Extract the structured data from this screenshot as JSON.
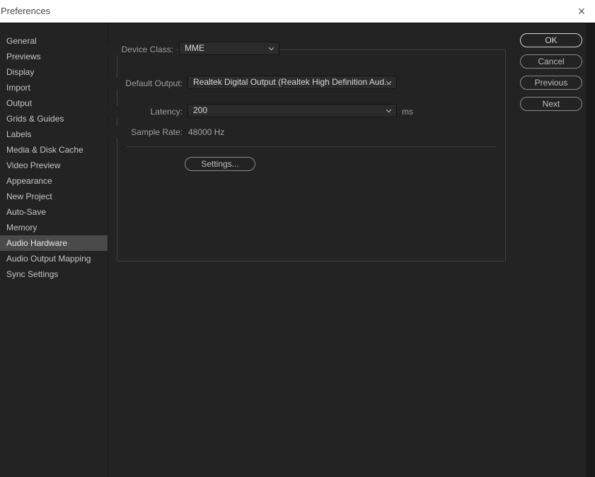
{
  "window": {
    "title": "Preferences",
    "close_glyph": "×"
  },
  "sidebar": {
    "items": [
      {
        "label": "General",
        "selected": false
      },
      {
        "label": "Previews",
        "selected": false
      },
      {
        "label": "Display",
        "selected": false
      },
      {
        "label": "Import",
        "selected": false
      },
      {
        "label": "Output",
        "selected": false
      },
      {
        "label": "Grids & Guides",
        "selected": false
      },
      {
        "label": "Labels",
        "selected": false
      },
      {
        "label": "Media & Disk Cache",
        "selected": false
      },
      {
        "label": "Video Preview",
        "selected": false
      },
      {
        "label": "Appearance",
        "selected": false
      },
      {
        "label": "New Project",
        "selected": false
      },
      {
        "label": "Auto-Save",
        "selected": false
      },
      {
        "label": "Memory",
        "selected": false
      },
      {
        "label": "Audio Hardware",
        "selected": true
      },
      {
        "label": "Audio Output Mapping",
        "selected": false
      },
      {
        "label": "Sync Settings",
        "selected": false
      }
    ]
  },
  "panel": {
    "device_class_label": "Device Class:",
    "device_class_value": "MME",
    "default_output_label": "Default Output:",
    "default_output_value": "Realtek Digital Output (Realtek High Definition Aud...",
    "latency_label": "Latency:",
    "latency_value": "200",
    "latency_unit": "ms",
    "sample_rate_label": "Sample Rate:",
    "sample_rate_value": "48000 Hz",
    "settings_button_label": "Settings..."
  },
  "action_buttons": {
    "ok": "OK",
    "cancel": "Cancel",
    "previous": "Previous",
    "next": "Next"
  },
  "colors": {
    "dialog_bg": "#232323",
    "titlebar_bg": "#ffffff",
    "selected_item_bg": "#4a4a4a",
    "default_button_border": "#d2d2d2"
  }
}
